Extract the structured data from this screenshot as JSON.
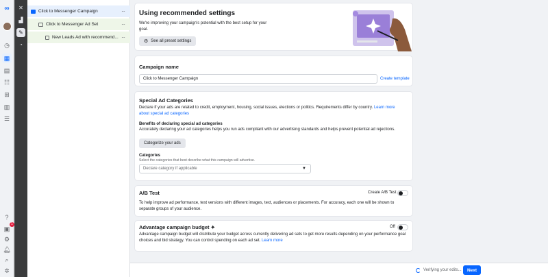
{
  "tree": {
    "campaign": "Click to Messenger Campaign",
    "adset": "Click to Messenger Ad Set",
    "ad": "New Leads Ad with recommend...",
    "more": "···"
  },
  "recommended": {
    "title": "Using recommended settings",
    "body": "We're improving your campaign's potential with the best setup for your goal.",
    "button": "See all preset settings"
  },
  "campaign_name": {
    "title": "Campaign name",
    "value": "Click to Messenger Campaign",
    "create_template": "Create template"
  },
  "special_ads": {
    "title": "Special Ad Categories",
    "body": "Declare if your ads are related to credit, employment, housing, social issues, elections or politics. Requirements differ by country.",
    "learn_more": "Learn more about special ad categories",
    "benefits_title": "Benefits of declaring special ad categories",
    "benefits_body": "Accurately declaring your ad categories helps you run ads compliant with our advertising standards and helps prevent potential ad rejections.",
    "categorize_button": "Categorize your ads",
    "categories_label": "Categories",
    "categories_hint": "Select the categories that best describe what this campaign will advertise.",
    "select_placeholder": "Declare category if applicable"
  },
  "ab_test": {
    "title": "A/B Test",
    "toggle_label": "Create A/B Test",
    "body": "To help improve ad performance, test versions with different images, text, audiences or placements. For accuracy, each one will be shown to separate groups of your audience."
  },
  "budget": {
    "title": "Advantage campaign budget ✦",
    "toggle_label": "Off",
    "body": "Advantage campaign budget will distribute your budget across currently delivering ad sets to get more results depending on your performance goal choices and bid strategy. You can control spending on each ad set.",
    "learn_more": "Learn more"
  },
  "footer": {
    "status": "Verifying your edits...",
    "next": "Next"
  },
  "rail": {
    "notification_count": "1",
    "help": "?"
  },
  "colors": {
    "accent": "#0866ff",
    "tree_selected": "#e7f0fd",
    "tree_child": "#eef6e8",
    "tool_column": "#3a3b3c"
  }
}
